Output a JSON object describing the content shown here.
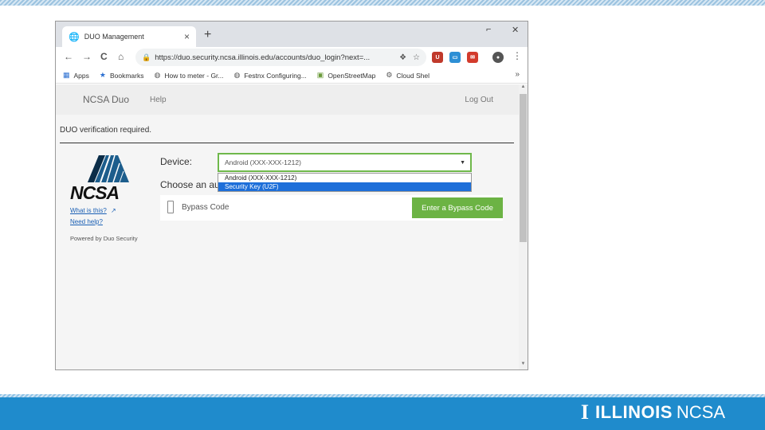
{
  "slide": {
    "brand_primary": "ILLINOIS",
    "brand_secondary": "NCSA",
    "band_color": "#1f8bcc"
  },
  "browser": {
    "tab": {
      "title": "DUO Management",
      "favicon": "globe-icon",
      "close": "×"
    },
    "new_tab": "+",
    "window_controls": {
      "minimize": "⌐",
      "close": "✕"
    },
    "nav": {
      "back": "←",
      "forward": "→",
      "reload": "C",
      "home": "⌂"
    },
    "url": "https://duo.security.ncsa.illinois.edu/accounts/duo_login?next=...",
    "bookmarks": [
      {
        "label": "Apps",
        "icon": "apps-grid-icon"
      },
      {
        "label": "Bookmarks",
        "icon": "star-icon"
      },
      {
        "label": "How to meter - Gr...",
        "icon": "globe-icon"
      },
      {
        "label": "Festnx Configuring...",
        "icon": "globe-icon"
      },
      {
        "label": "OpenStreetMap",
        "icon": "map-icon"
      },
      {
        "label": "Cloud Shel",
        "icon": "gear-icon"
      }
    ],
    "bookmarks_more": "»"
  },
  "site": {
    "brand": "NCSA Duo",
    "help": "Help",
    "logout": "Log Out",
    "notice": "DUO verification required."
  },
  "duo": {
    "logo_text": "NCSA",
    "what_is_this": "What is this?",
    "need_help": "Need help?",
    "powered_by": "Powered by Duo Security",
    "device_label": "Device:",
    "selected_device": "Android (XXX-XXX-1212)",
    "options": [
      "Android (XXX-XXX-1212)",
      "Security Key (U2F)"
    ],
    "highlighted_option": "Security Key (U2F)",
    "choose_label": "Choose an au",
    "method_label": "Bypass Code",
    "bypass_button": "Enter a Bypass Code",
    "accent_green": "#6cb344"
  }
}
